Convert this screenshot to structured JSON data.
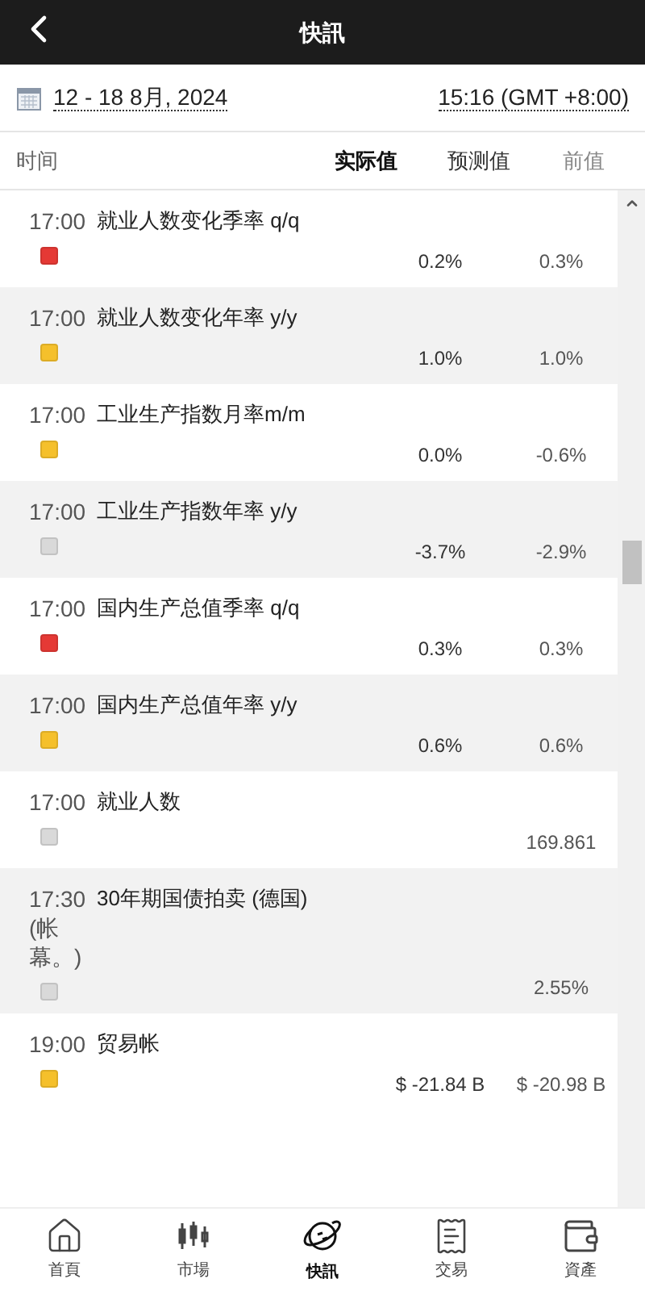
{
  "header": {
    "title": "快訊"
  },
  "date_bar": {
    "date_range": "12 - 18 8月, 2024",
    "timezone": "15:16 (GMT +8:00)"
  },
  "columns": {
    "time": "时间",
    "actual": "实际值",
    "forecast": "预测值",
    "previous": "前值"
  },
  "events": [
    {
      "time": "17:00",
      "name": "就业人数变化季率 q/q",
      "color": "#e53935",
      "forecast": "0.2%",
      "previous": "0.3%"
    },
    {
      "time": "17:00",
      "name": "就业人数变化年率 y/y",
      "color": "#f5c02b",
      "forecast": "1.0%",
      "previous": "1.0%"
    },
    {
      "time": "17:00",
      "name": "工业生产指数月率m/m",
      "color": "#f5c02b",
      "forecast": "0.0%",
      "previous": "-0.6%"
    },
    {
      "time": "17:00",
      "name": "工业生产指数年率 y/y",
      "color": "#d9d9d9",
      "forecast": "-3.7%",
      "previous": "-2.9%"
    },
    {
      "time": "17:00",
      "name": "国内生产总值季率 q/q",
      "color": "#e53935",
      "forecast": "0.3%",
      "previous": "0.3%"
    },
    {
      "time": "17:00",
      "name": "国内生产总值年率 y/y",
      "color": "#f5c02b",
      "forecast": "0.6%",
      "previous": "0.6%"
    },
    {
      "time": "17:00",
      "name": "就业人数",
      "color": "#d9d9d9",
      "previous": "169.861"
    },
    {
      "time": "17:30 (帐幕。)",
      "name": "30年期国债拍卖 (德国)",
      "color": "#d9d9d9",
      "previous": "2.55%"
    },
    {
      "time": "19:00",
      "name": "贸易帐",
      "color": "#f5c02b",
      "forecast": "$ -21.84 B",
      "previous": "$ -20.98 B"
    }
  ],
  "nav": [
    {
      "kind": "home",
      "label": "首頁",
      "selected": false
    },
    {
      "kind": "market",
      "label": "市場",
      "selected": false
    },
    {
      "kind": "news",
      "label": "快訊",
      "selected": true
    },
    {
      "kind": "trade",
      "label": "交易",
      "selected": false
    },
    {
      "kind": "assets",
      "label": "資產",
      "selected": false
    }
  ]
}
